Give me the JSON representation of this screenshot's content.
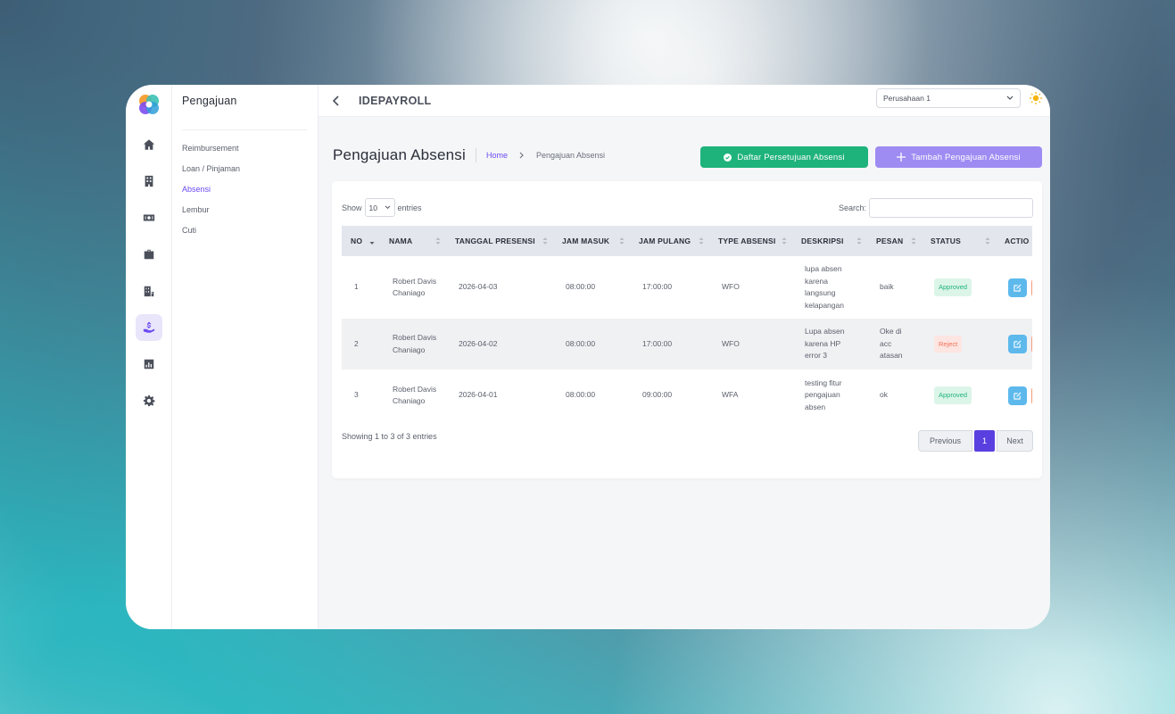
{
  "colors": {
    "accent": "#6c4cf1",
    "green": "#1fb37c",
    "purple_light": "#9e8cf3",
    "info": "#5db9ec",
    "danger": "#f79a7c"
  },
  "rail": {
    "items": [
      {
        "icon": "home-icon"
      },
      {
        "icon": "building-icon"
      },
      {
        "icon": "money-icon"
      },
      {
        "icon": "briefcase-icon"
      },
      {
        "icon": "office-icon"
      },
      {
        "icon": "hand-money-icon",
        "active": true
      },
      {
        "icon": "chart-icon"
      },
      {
        "icon": "gear-icon"
      }
    ]
  },
  "submenu": {
    "title": "Pengajuan",
    "items": [
      {
        "label": "Reimbursement"
      },
      {
        "label": "Loan / Pinjaman"
      },
      {
        "label": "Absensi",
        "active": true
      },
      {
        "label": "Lembur"
      },
      {
        "label": "Cuti"
      }
    ]
  },
  "topbar": {
    "brand": "IDEPAYROLL",
    "company": "Perusahaan 1"
  },
  "page": {
    "title": "Pengajuan Absensi",
    "breadcrumb": {
      "home": "Home",
      "current": "Pengajuan Absensi"
    },
    "btn_approval": "Daftar Persetujuan Absensi",
    "btn_add": "Tambah Pengajuan Absensi"
  },
  "table_controls": {
    "show_label": "Show",
    "show_value": "10",
    "entries_label": "entries",
    "search_label": "Search:"
  },
  "table": {
    "headers": [
      "NO",
      "NAMA",
      "TANGGAL PRESENSI",
      "JAM MASUK",
      "JAM PULANG",
      "TYPE ABSENSI",
      "DESKRIPSI",
      "PESAN",
      "STATUS",
      "ACTIO"
    ],
    "rows": [
      {
        "no": "1",
        "nama": "Robert Davis Chaniago",
        "tanggal": "2026-04-03",
        "masuk": "08:00:00",
        "pulang": "17:00:00",
        "type": "WFO",
        "deskripsi": "lupa absen karena langsung kelapangan",
        "pesan": "baik",
        "status": "Approved"
      },
      {
        "no": "2",
        "nama": "Robert Davis Chaniago",
        "tanggal": "2026-04-02",
        "masuk": "08:00:00",
        "pulang": "17:00:00",
        "type": "WFO",
        "deskripsi": "Lupa absen karena HP error 3",
        "pesan": "Oke di acc atasan",
        "status": "Reject"
      },
      {
        "no": "3",
        "nama": "Robert Davis Chaniago",
        "tanggal": "2026-04-01",
        "masuk": "08:00:00",
        "pulang": "09:00:00",
        "type": "WFA",
        "deskripsi": "testing fitur pengajuan absen",
        "pesan": "ok",
        "status": "Approved"
      }
    ]
  },
  "footer": {
    "info": "Showing 1 to 3 of 3 entries",
    "prev": "Previous",
    "current_page": "1",
    "next": "Next"
  }
}
